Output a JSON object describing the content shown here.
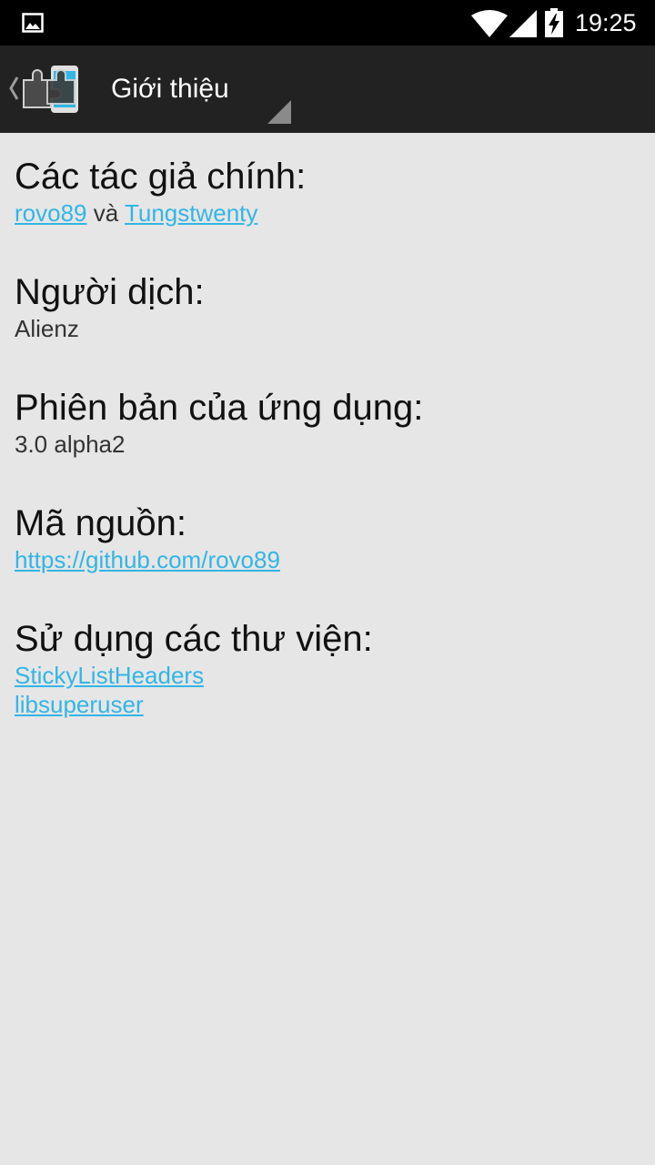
{
  "status_bar": {
    "time": "19:25",
    "icons": [
      "gallery-icon",
      "wifi-icon",
      "signal-icon",
      "battery-charging-icon"
    ]
  },
  "action_bar": {
    "title": "Giới thiệu",
    "icons": [
      "up-caret-icon",
      "puzzle-app-icon",
      "spinner-corner-icon"
    ]
  },
  "sections": {
    "authors": {
      "heading": "Các tác giả chính:",
      "author1": "rovo89",
      "separator": "và",
      "author2": "Tungstwenty"
    },
    "translator": {
      "heading": "Người dịch:",
      "value": "Alienz"
    },
    "version": {
      "heading": "Phiên bản của ứng dụng:",
      "value": "3.0 alpha2"
    },
    "source": {
      "heading": "Mã nguồn:",
      "link": "https://github.com/rovo89"
    },
    "libraries": {
      "heading": "Sử dụng các thư viện:",
      "items": [
        "StickyListHeaders",
        "libsuperuser"
      ]
    }
  },
  "colors": {
    "status_bar": "#000000",
    "action_bar": "#222222",
    "background": "#e6e6e6",
    "link": "#33b5e5",
    "accent_icon": "#33b5e5"
  }
}
